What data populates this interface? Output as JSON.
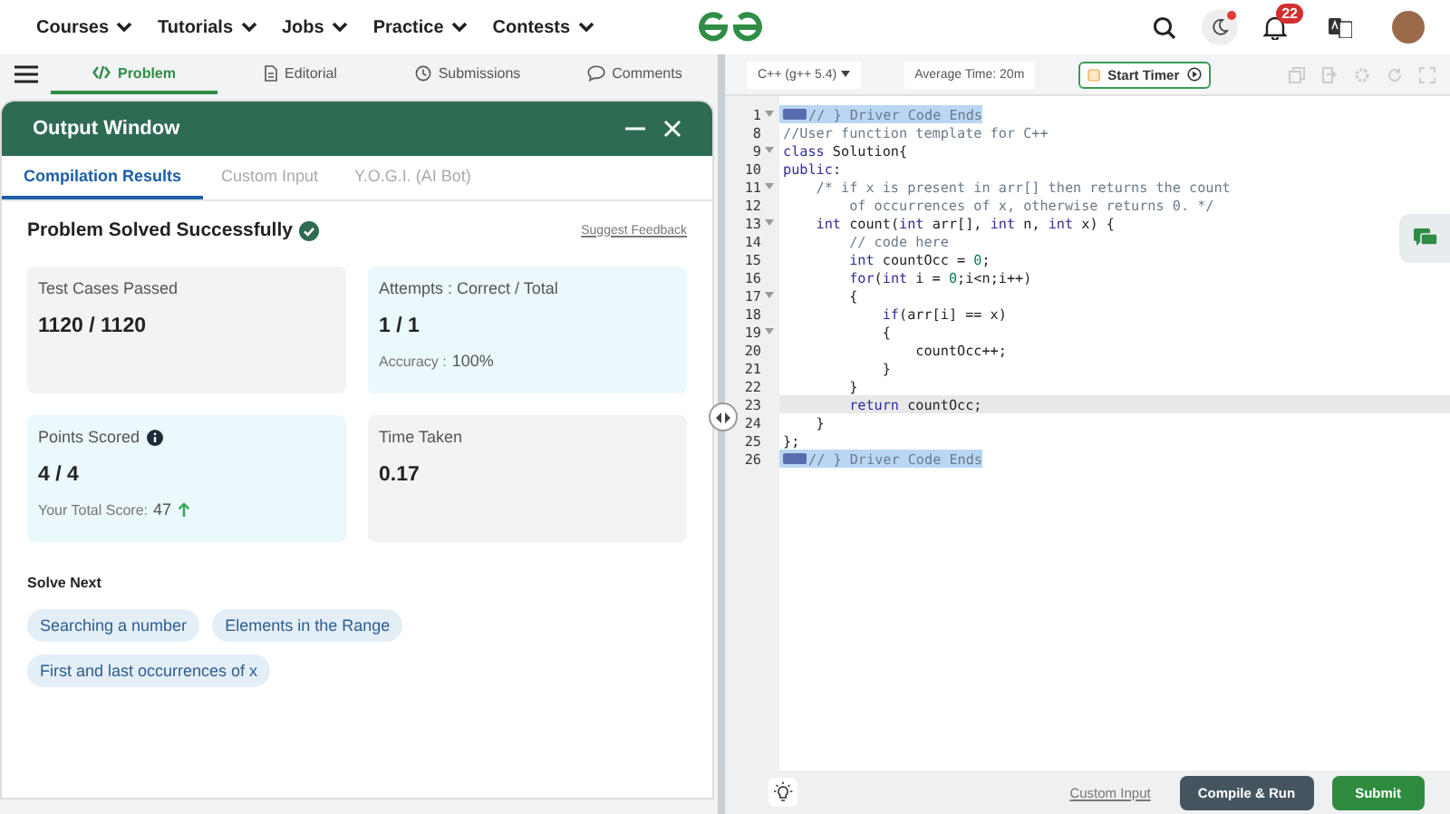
{
  "nav": {
    "items": [
      "Courses",
      "Tutorials",
      "Jobs",
      "Practice",
      "Contests"
    ],
    "notifications": "22",
    "theme_dot": true
  },
  "problem_tabs": [
    {
      "label": "Problem",
      "kind": "code",
      "selected": true
    },
    {
      "label": "Editorial",
      "kind": "doc",
      "selected": false
    },
    {
      "label": "Submissions",
      "kind": "clock",
      "selected": false
    },
    {
      "label": "Comments",
      "kind": "chat",
      "selected": false
    }
  ],
  "output_window": {
    "title": "Output Window",
    "tabs": [
      {
        "label": "Compilation Results",
        "selected": true
      },
      {
        "label": "Custom Input",
        "selected": false
      },
      {
        "label": "Y.O.G.I. (AI Bot)",
        "selected": false
      }
    ],
    "status": "Problem Solved Successfully",
    "feedback_link": "Suggest Feedback",
    "cards": [
      {
        "label": "Test Cases Passed",
        "value": "1120 / 1120",
        "kind": "plain"
      },
      {
        "label": "Attempts : Correct / Total",
        "value": "1 / 1",
        "note_label": "Accuracy :",
        "note_value": "100%",
        "kind": "highlight"
      },
      {
        "label": "Points Scored",
        "info": true,
        "value": "4 / 4",
        "note_label": "Your Total Score:",
        "note_value": "47",
        "trend_up": true,
        "kind": "highlight"
      },
      {
        "label": "Time Taken",
        "value": "0.17",
        "kind": "plain"
      }
    ],
    "solve_next_title": "Solve Next",
    "solve_next": [
      "Searching a number",
      "Elements in the Range",
      "First and last occurrences of x"
    ]
  },
  "editor": {
    "language": "C++ (g++ 5.4)",
    "average_time": "Average Time: 20m",
    "timer_button": "Start Timer",
    "lines": [
      {
        "num": "1",
        "fold": true,
        "folded": true,
        "selected": true,
        "current": false,
        "tokens": [
          {
            "kind": "comment",
            "text": "// } Driver Code Ends"
          }
        ]
      },
      {
        "num": "8",
        "fold": false,
        "folded": false,
        "selected": false,
        "current": false,
        "tokens": [
          {
            "kind": "comment",
            "text": "//User function template for C++"
          }
        ]
      },
      {
        "num": "9",
        "fold": true,
        "folded": false,
        "selected": false,
        "current": false,
        "tokens": [
          {
            "kind": "keyword",
            "text": "class"
          },
          {
            "kind": "plain",
            "text": " Solution{"
          }
        ]
      },
      {
        "num": "10",
        "fold": false,
        "folded": false,
        "selected": false,
        "current": false,
        "tokens": [
          {
            "kind": "keyword",
            "text": "public"
          },
          {
            "kind": "plain",
            "text": ":"
          }
        ]
      },
      {
        "num": "11",
        "fold": true,
        "folded": false,
        "selected": false,
        "current": false,
        "tokens": [
          {
            "kind": "comment",
            "text": "    /* if x is present in arr[] then returns the count"
          }
        ]
      },
      {
        "num": "12",
        "fold": false,
        "folded": false,
        "selected": false,
        "current": false,
        "tokens": [
          {
            "kind": "comment",
            "text": "        of occurrences of x, otherwise returns 0. */"
          }
        ]
      },
      {
        "num": "13",
        "fold": true,
        "folded": false,
        "selected": false,
        "current": false,
        "tokens": [
          {
            "kind": "keyword",
            "text": "    int"
          },
          {
            "kind": "plain",
            "text": " count("
          },
          {
            "kind": "keyword",
            "text": "int"
          },
          {
            "kind": "plain",
            "text": " arr[], "
          },
          {
            "kind": "keyword",
            "text": "int"
          },
          {
            "kind": "plain",
            "text": " n, "
          },
          {
            "kind": "keyword",
            "text": "int"
          },
          {
            "kind": "plain",
            "text": " x) {"
          }
        ]
      },
      {
        "num": "14",
        "fold": false,
        "folded": false,
        "selected": false,
        "current": false,
        "tokens": [
          {
            "kind": "comment",
            "text": "        // code here"
          }
        ]
      },
      {
        "num": "15",
        "fold": false,
        "folded": false,
        "selected": false,
        "current": false,
        "tokens": [
          {
            "kind": "keyword",
            "text": "        int"
          },
          {
            "kind": "plain",
            "text": " countOcc = "
          },
          {
            "kind": "number",
            "text": "0"
          },
          {
            "kind": "plain",
            "text": ";"
          }
        ]
      },
      {
        "num": "16",
        "fold": false,
        "folded": false,
        "selected": false,
        "current": false,
        "tokens": [
          {
            "kind": "keyword",
            "text": "        for"
          },
          {
            "kind": "plain",
            "text": "("
          },
          {
            "kind": "keyword",
            "text": "int"
          },
          {
            "kind": "plain",
            "text": " i = "
          },
          {
            "kind": "number",
            "text": "0"
          },
          {
            "kind": "plain",
            "text": ";i<n;i++)"
          }
        ]
      },
      {
        "num": "17",
        "fold": true,
        "folded": false,
        "selected": false,
        "current": false,
        "tokens": [
          {
            "kind": "plain",
            "text": "        {"
          }
        ]
      },
      {
        "num": "18",
        "fold": false,
        "folded": false,
        "selected": false,
        "current": false,
        "tokens": [
          {
            "kind": "keyword",
            "text": "            if"
          },
          {
            "kind": "plain",
            "text": "(arr[i] == x)"
          }
        ]
      },
      {
        "num": "19",
        "fold": true,
        "folded": false,
        "selected": false,
        "current": false,
        "tokens": [
          {
            "kind": "plain",
            "text": "            {"
          }
        ]
      },
      {
        "num": "20",
        "fold": false,
        "folded": false,
        "selected": false,
        "current": false,
        "tokens": [
          {
            "kind": "plain",
            "text": "                countOcc++;"
          }
        ]
      },
      {
        "num": "21",
        "fold": false,
        "folded": false,
        "selected": false,
        "current": false,
        "tokens": [
          {
            "kind": "plain",
            "text": "            }"
          }
        ]
      },
      {
        "num": "22",
        "fold": false,
        "folded": false,
        "selected": false,
        "current": false,
        "tokens": [
          {
            "kind": "plain",
            "text": "        }"
          }
        ]
      },
      {
        "num": "23",
        "fold": false,
        "folded": false,
        "selected": false,
        "current": true,
        "tokens": [
          {
            "kind": "keyword",
            "text": "        return"
          },
          {
            "kind": "plain",
            "text": " countOcc;"
          }
        ]
      },
      {
        "num": "24",
        "fold": false,
        "folded": false,
        "selected": false,
        "current": false,
        "tokens": [
          {
            "kind": "plain",
            "text": "    }"
          }
        ]
      },
      {
        "num": "25",
        "fold": false,
        "folded": false,
        "selected": false,
        "current": false,
        "tokens": [
          {
            "kind": "plain",
            "text": "};"
          }
        ]
      },
      {
        "num": "26",
        "fold": false,
        "folded": true,
        "selected": true,
        "current": false,
        "tokens": [
          {
            "kind": "comment",
            "text": "// } Driver Code Ends"
          }
        ]
      }
    ],
    "custom_input_link": "Custom Input",
    "compile_button": "Compile & Run",
    "submit_button": "Submit"
  }
}
